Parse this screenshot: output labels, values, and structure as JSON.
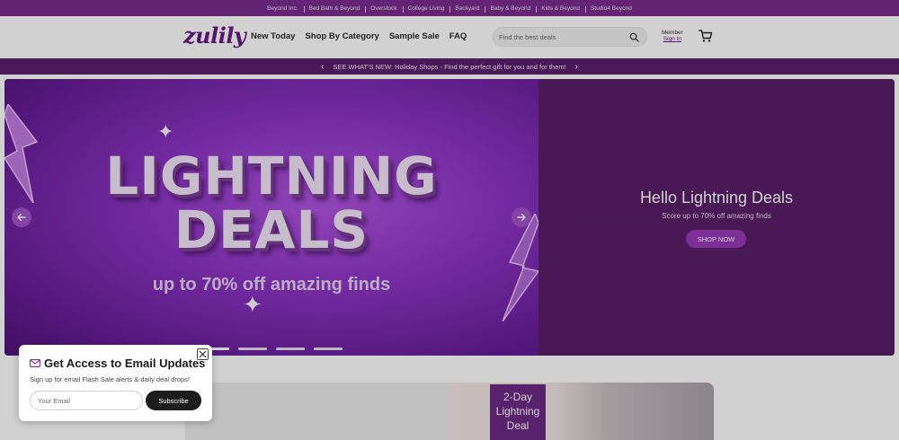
{
  "topbar": {
    "links": [
      "Beyond Inc.",
      "Bed Bath & Beyond",
      "Overstock",
      "College Living",
      "Backyard",
      "Baby & Beyond",
      "Kids & Beyond",
      "Studio4 Beyond"
    ]
  },
  "header": {
    "logo": "zulily",
    "nav": [
      "New Today",
      "Shop By Category",
      "Sample Sale",
      "FAQ"
    ],
    "search_placeholder": "Find the best deals",
    "member_label": "Member",
    "sign_in_label": "Sign In"
  },
  "announcement": {
    "text": "SEE WHAT'S NEW: Holiday Shops - Find the perfect gift for you and for them!"
  },
  "hero": {
    "headline_line1": "LIGHTNING",
    "headline_line2": "DEALS",
    "subheadline": "up to 70% off amazing finds",
    "title": "Hello Lightning Deals",
    "description": "Score up to 70% off amazing finds",
    "button_label": "SHOP NOW",
    "slide_count": 4,
    "active_slide": 1,
    "colors": {
      "accent": "#9a3ab8",
      "panel": "#5a1f68",
      "brand": "#6a1b85"
    }
  },
  "promo": {
    "badge_line1": "2-Day",
    "badge_line2": "Lightning",
    "badge_line3": "Deal"
  },
  "popup": {
    "title": "Get Access to Email Updates",
    "description": "Sign up for email Flash Sale alerts & daily deal drops!",
    "email_placeholder": "Your Email",
    "subscribe_label": "Subscribe"
  }
}
